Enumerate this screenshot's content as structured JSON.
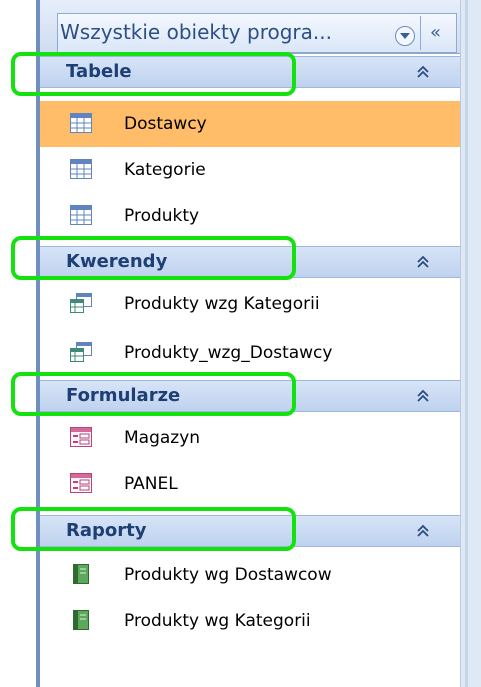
{
  "header": {
    "title": "Wszystkie obiekty progra...",
    "collapse_glyph": "«"
  },
  "groups": [
    {
      "label": "Tabele",
      "items": [
        {
          "label": "Dostawcy",
          "icon": "table-icon",
          "selected": true
        },
        {
          "label": "Kategorie",
          "icon": "table-icon"
        },
        {
          "label": "Produkty",
          "icon": "table-icon"
        }
      ]
    },
    {
      "label": "Kwerendy",
      "items": [
        {
          "label": "Produkty wzg Kategorii",
          "icon": "query-icon"
        },
        {
          "label": "Produkty_wzg_Dostawcy",
          "icon": "query-icon"
        }
      ]
    },
    {
      "label": "Formularze",
      "items": [
        {
          "label": "Magazyn",
          "icon": "form-icon"
        },
        {
          "label": "PANEL",
          "icon": "form-icon"
        }
      ]
    },
    {
      "label": "Raporty",
      "items": [
        {
          "label": "Produkty wg Dostawcow",
          "icon": "report-icon"
        },
        {
          "label": "Produkty wg Kategorii",
          "icon": "report-icon"
        }
      ]
    }
  ],
  "colors": {
    "selected_row": "#ffbd69",
    "highlight_box": "#14e20f",
    "group_header": "#bfd2ee"
  }
}
